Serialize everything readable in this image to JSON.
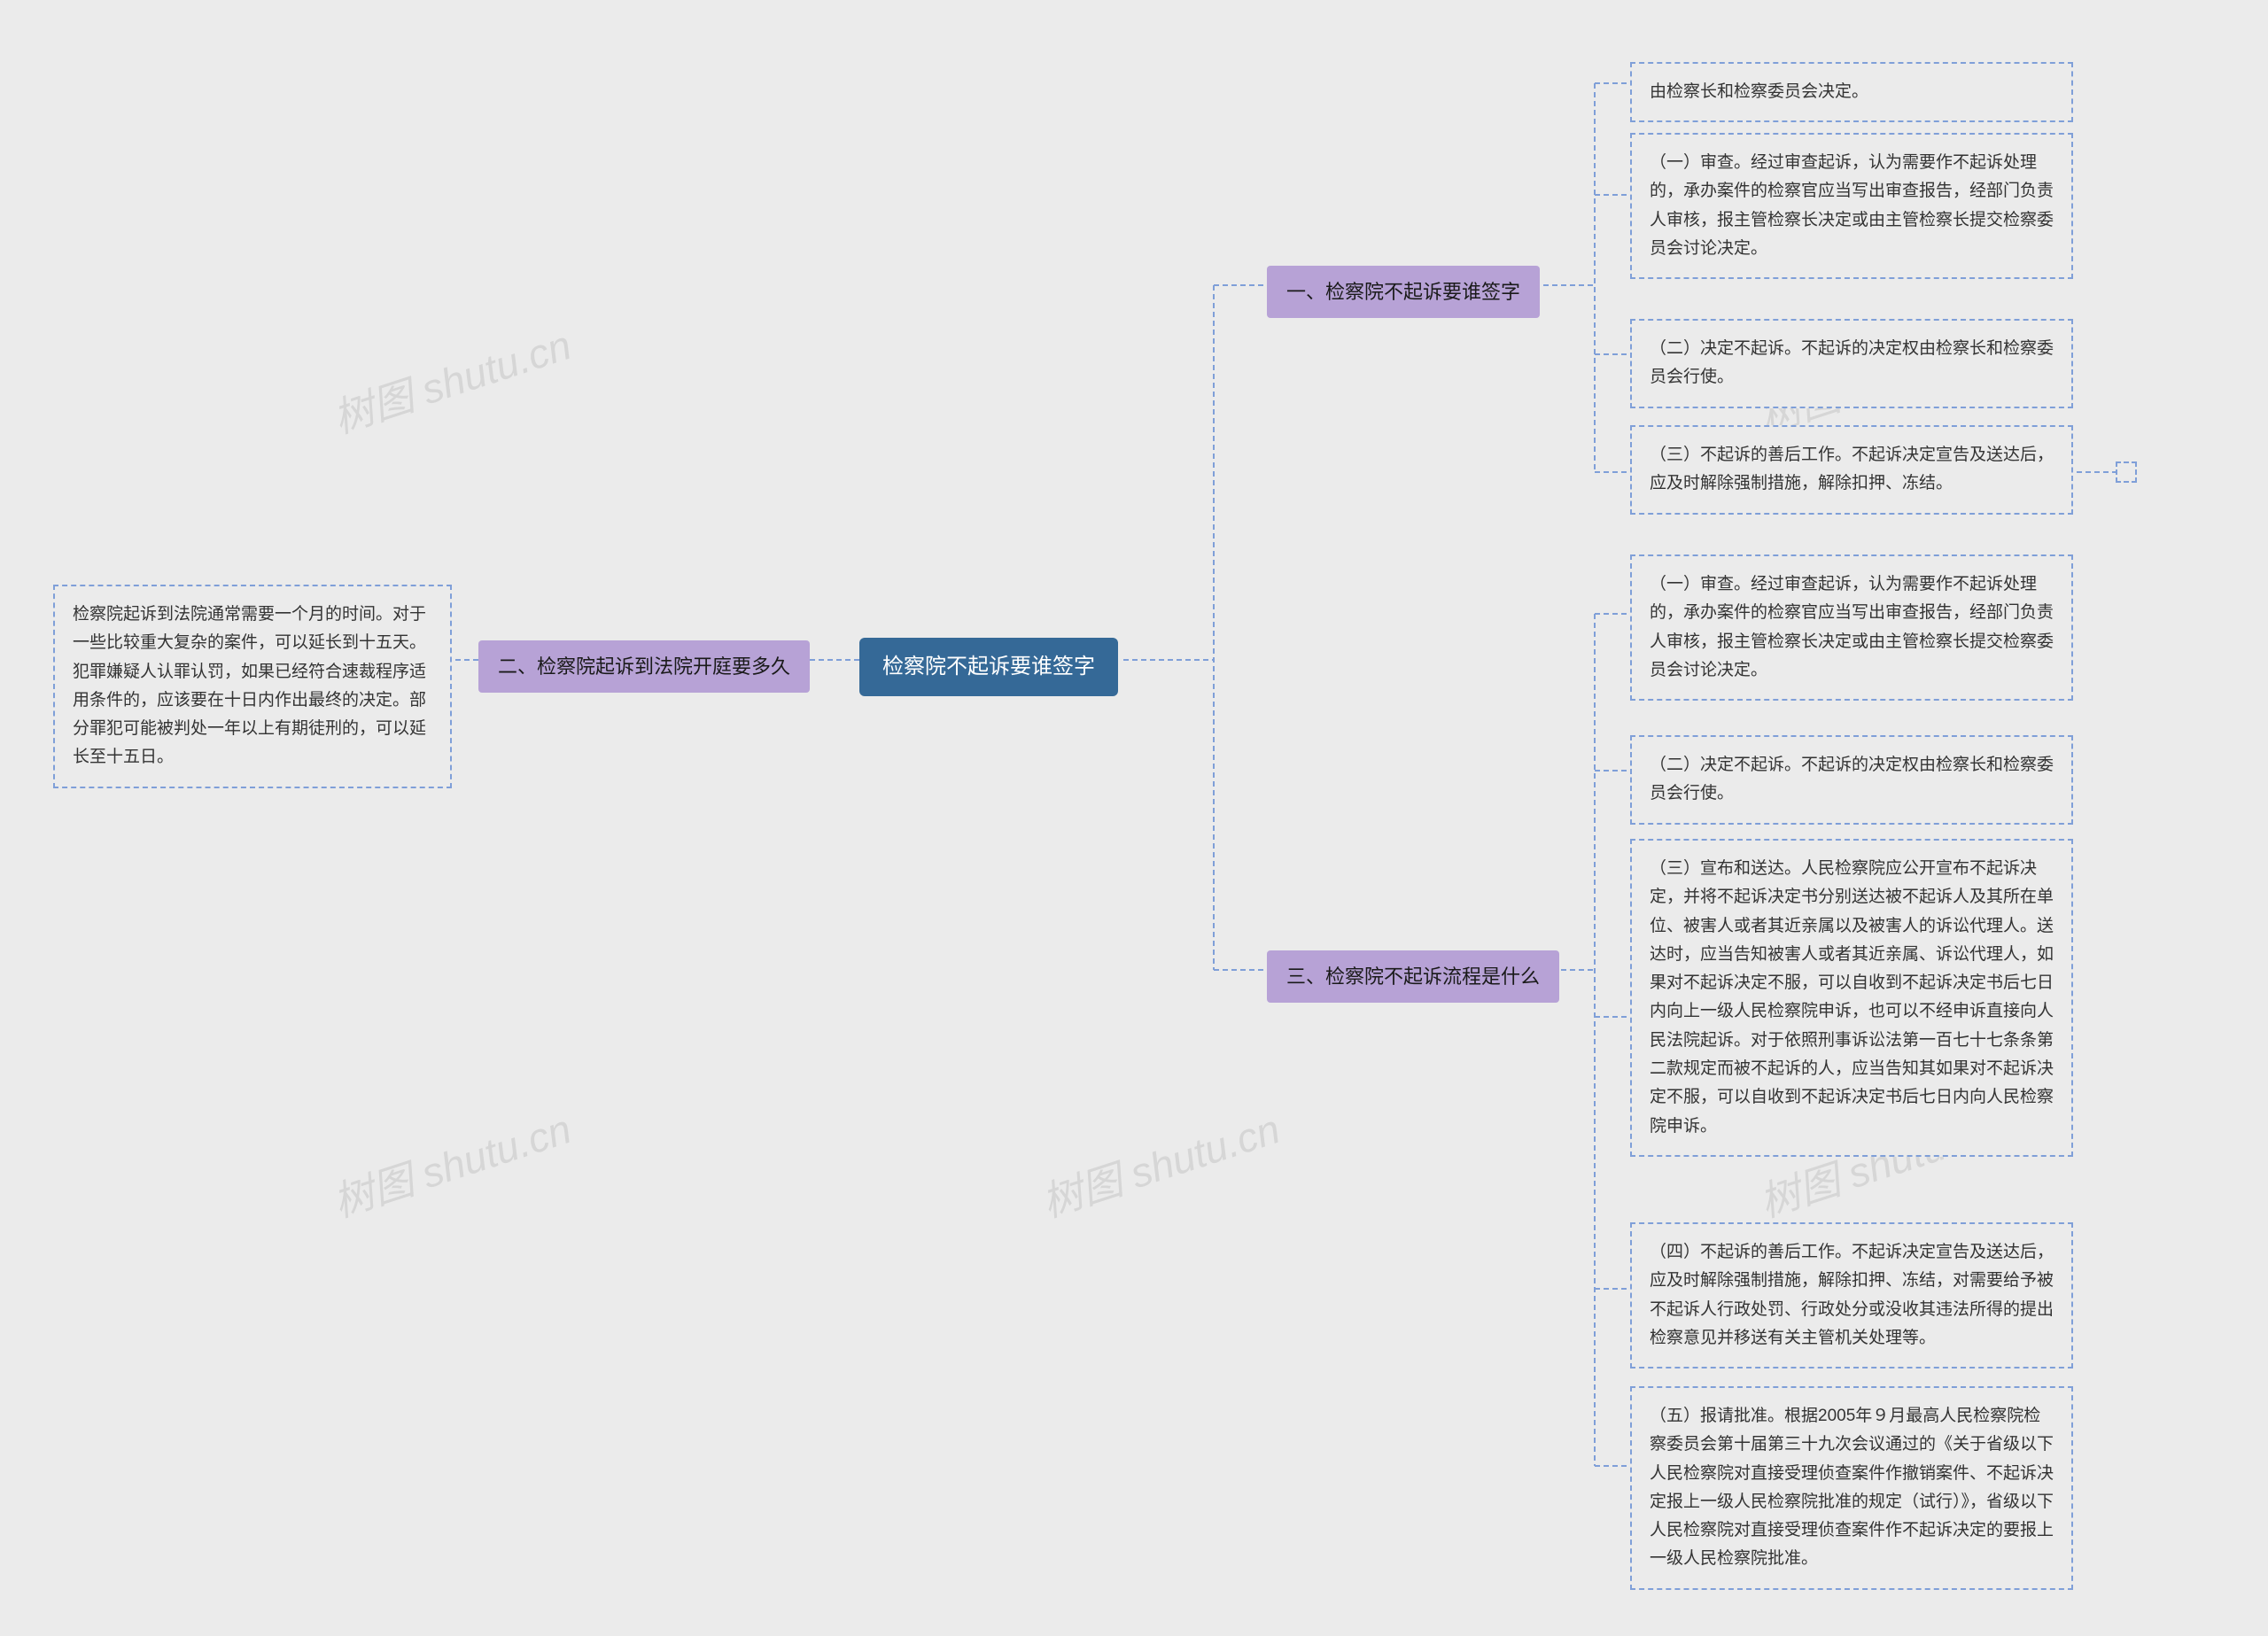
{
  "root": {
    "title": "检察院不起诉要谁签字"
  },
  "branches": {
    "b1": {
      "label": "一、检察院不起诉要谁签字"
    },
    "b2": {
      "label": "二、检察院起诉到法院开庭要多久"
    },
    "b3": {
      "label": "三、检察院不起诉流程是什么"
    }
  },
  "leaves": {
    "b1_l1": "由检察长和检察委员会决定。",
    "b1_l2": "（一）审查。经过审查起诉，认为需要作不起诉处理的，承办案件的检察官应当写出审查报告，经部门负责人审核，报主管检察长决定或由主管检察长提交检察委员会讨论决定。",
    "b1_l3": "（二）决定不起诉。不起诉的决定权由检察长和检察委员会行使。",
    "b1_l4": "（三）不起诉的善后工作。不起诉决定宣告及送达后，应及时解除强制措施，解除扣押、冻结。",
    "b2_l1": "检察院起诉到法院通常需要一个月的时间。对于一些比较重大复杂的案件，可以延长到十五天。犯罪嫌疑人认罪认罚，如果已经符合速裁程序适用条件的，应该要在十日内作出最终的决定。部分罪犯可能被判处一年以上有期徒刑的，可以延长至十五日。",
    "b3_l1": "（一）审查。经过审查起诉，认为需要作不起诉处理的，承办案件的检察官应当写出审查报告，经部门负责人审核，报主管检察长决定或由主管检察长提交检察委员会讨论决定。",
    "b3_l2": "（二）决定不起诉。不起诉的决定权由检察长和检察委员会行使。",
    "b3_l3": "（三）宣布和送达。人民检察院应公开宣布不起诉决定，并将不起诉决定书分别送达被不起诉人及其所在单位、被害人或者其近亲属以及被害人的诉讼代理人。送达时，应当告知被害人或者其近亲属、诉讼代理人，如果对不起诉决定不服，可以自收到不起诉决定书后七日内向上一级人民检察院申诉，也可以不经申诉直接向人民法院起诉。对于依照刑事诉讼法第一百七十七条条第二款规定而被不起诉的人，应当告知其如果对不起诉决定不服，可以自收到不起诉决定书后七日内向人民检察院申诉。",
    "b3_l4": "（四）不起诉的善后工作。不起诉决定宣告及送达后，应及时解除强制措施，解除扣押、冻结，对需要给予被不起诉人行政处罚、行政处分或没收其违法所得的提出检察意见并移送有关主管机关处理等。",
    "b3_l5": "（五）报请批准。根据2005年９月最高人民检察院检察委员会第十届第三十九次会议通过的《关于省级以下人民检察院对直接受理侦查案件作撤销案件、不起诉决定报上一级人民检察院批准的规定（试行）》，省级以下人民检察院对直接受理侦查案件作不起诉决定的要报上一级人民检察院批准。"
  },
  "watermark": "树图 shutu.cn"
}
